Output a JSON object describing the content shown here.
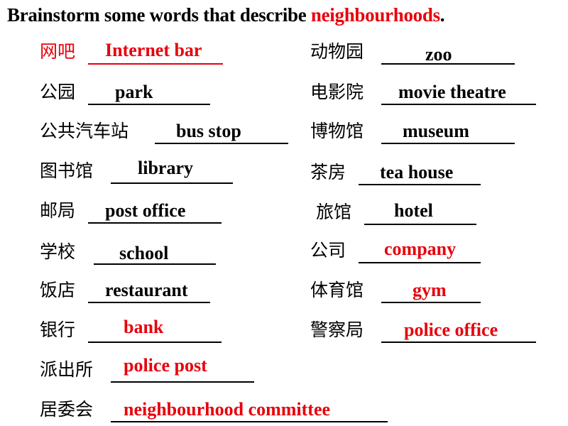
{
  "title": {
    "prefix": "Brainstorm some words that describe ",
    "highlight": "neighbourhoods",
    "suffix": "."
  },
  "colors": {
    "answer_red": "#e8000b",
    "text": "#000000"
  },
  "left_column": [
    {
      "chinese": "网吧",
      "english": "Internet bar",
      "highlighted": true
    },
    {
      "chinese": "公园",
      "english": "park",
      "highlighted": false
    },
    {
      "chinese": "公共汽车站",
      "english": "bus stop",
      "highlighted": false
    },
    {
      "chinese": "图书馆",
      "english": "library",
      "highlighted": false
    },
    {
      "chinese": "邮局",
      "english": "post office",
      "highlighted": false
    },
    {
      "chinese": "学校",
      "english": "school",
      "highlighted": false
    },
    {
      "chinese": "饭店",
      "english": "restaurant",
      "highlighted": false
    },
    {
      "chinese": "银行",
      "english": "bank",
      "highlighted": true
    },
    {
      "chinese": "派出所",
      "english": "police post",
      "highlighted": true
    },
    {
      "chinese": "居委会",
      "english": "neighbourhood committee",
      "highlighted": true
    }
  ],
  "right_column": [
    {
      "chinese": "动物园",
      "english": "zoo",
      "highlighted": false
    },
    {
      "chinese": "电影院",
      "english": "movie theatre",
      "highlighted": false
    },
    {
      "chinese": "博物馆",
      "english": "museum",
      "highlighted": false
    },
    {
      "chinese": "茶房",
      "english": "tea house",
      "highlighted": false
    },
    {
      "chinese": "旅馆",
      "english": "hotel",
      "highlighted": false
    },
    {
      "chinese": "公司",
      "english": "company",
      "highlighted": true
    },
    {
      "chinese": "体育馆",
      "english": "gym",
      "highlighted": true
    },
    {
      "chinese": "警察局",
      "english": "police office",
      "highlighted": true
    }
  ]
}
